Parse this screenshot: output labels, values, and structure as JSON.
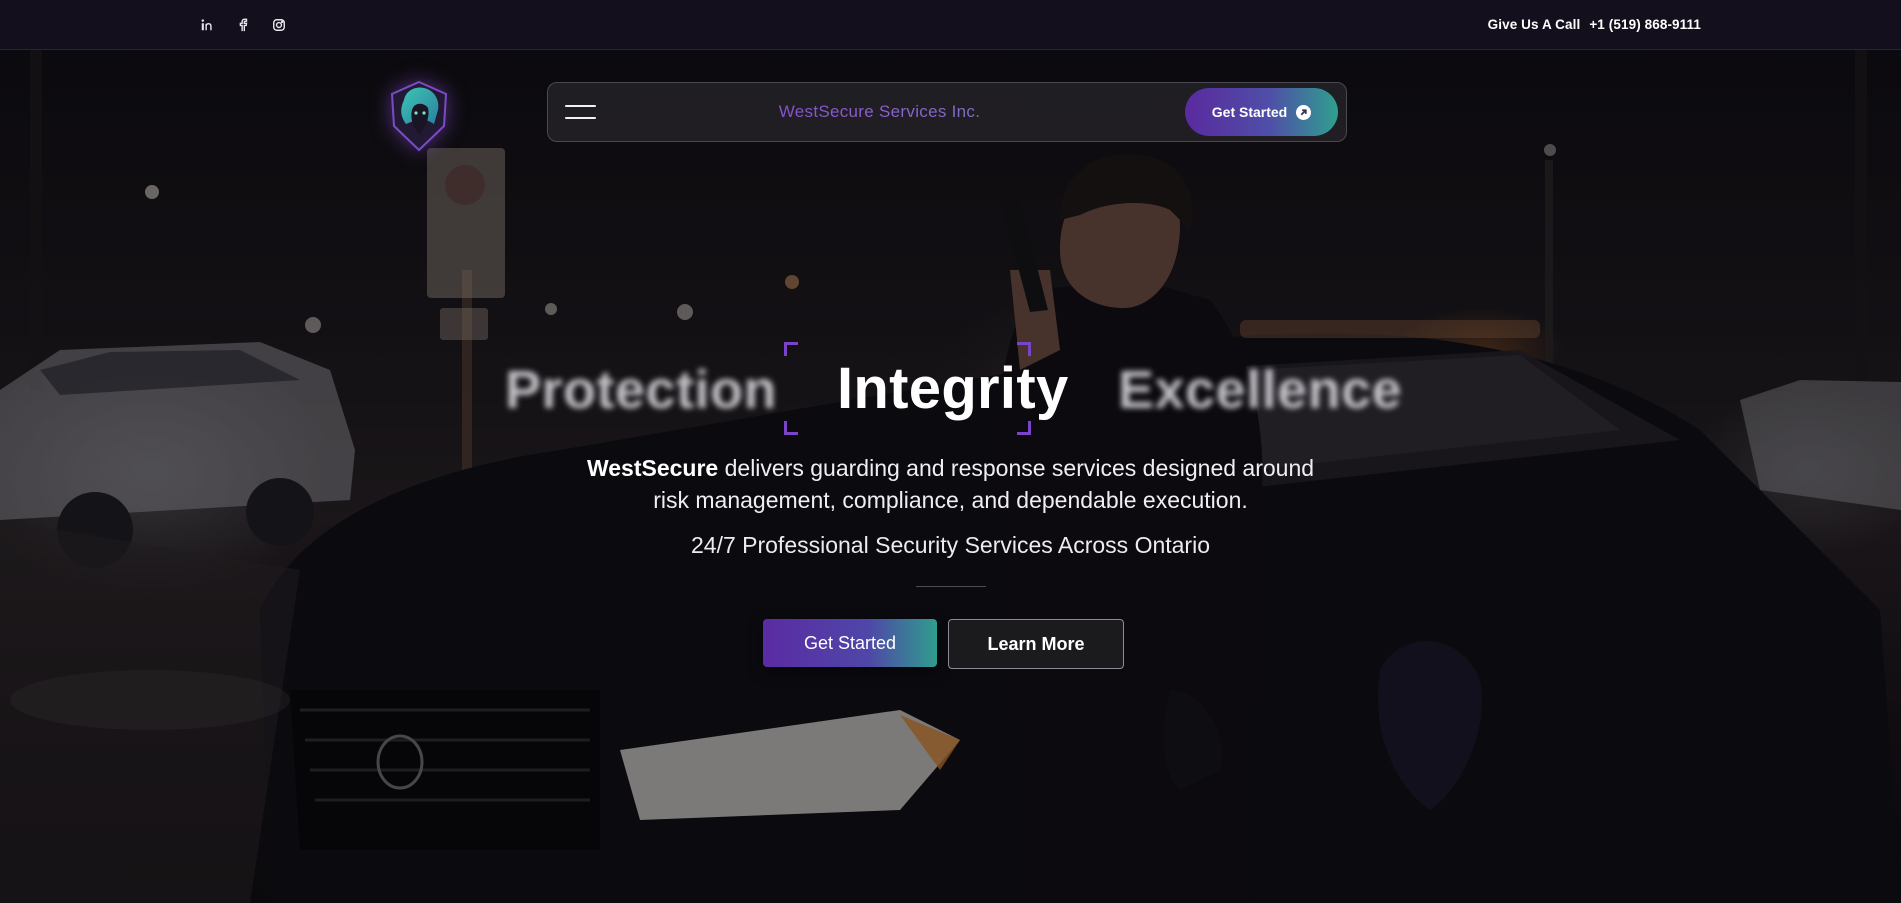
{
  "topbar": {
    "social_icons": [
      "linkedin-icon",
      "facebook-icon",
      "instagram-icon"
    ],
    "call_label": "Give Us A Call",
    "phone": "+1 (519) 868-9111"
  },
  "navbar": {
    "brand": "WestSecure Services Inc.",
    "cta_label": "Get Started"
  },
  "hero": {
    "words": {
      "left": "Protection",
      "active": "Integrity",
      "right": "Excellence"
    },
    "lede_brand": "WestSecure",
    "lede_line1": "delivers guarding and response services designed around",
    "lede_line2": "risk management, compliance, and dependable execution.",
    "tagline": "24/7 Professional Security Services Across Ontario",
    "primary_cta": "Get Started",
    "secondary_cta": "Learn More"
  },
  "colors": {
    "accent_purple": "#5b2ba3",
    "accent_teal": "#2f9d8e",
    "topbar_bg": "#140f1c"
  }
}
